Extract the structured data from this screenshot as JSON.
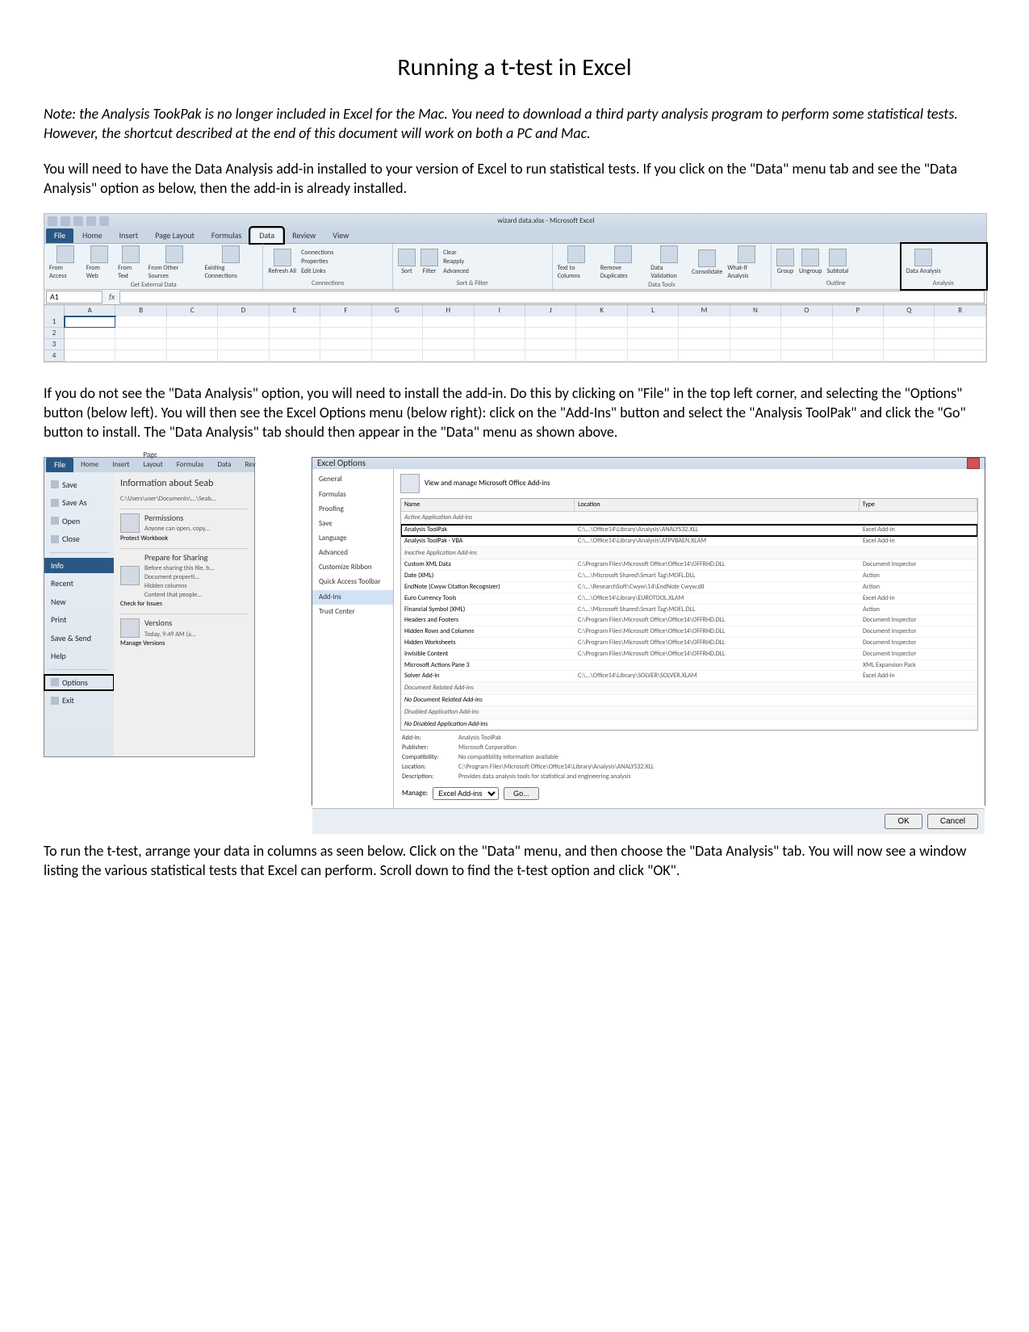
{
  "title": "Running a t-test in Excel",
  "note": "Note: the Analysis TookPak is no longer included in Excel for the Mac. You need to download a third party analysis program to perform some statistical tests. However, the shortcut described at the end of this document will work on both a PC and Mac.",
  "para1": "You will need to have the Data Analysis add-in installed to your version of Excel to run statistical tests. If you click on the \"Data\" menu tab and see the \"Data Analysis\" option as below, then the add-in is already installed.",
  "para2": "If you do not see the \"Data Analysis\" option, you will need to install the add-in. Do this by clicking on \"File\" in the top left corner, and selecting the \"Options\" button (below left). You will then see the Excel Options menu (below right): click on the \"Add-Ins\" button and select the \"Analysis ToolPak\" and click the \"Go\" button to install. The \"Data Analysis\" tab should then appear in the \"Data\" menu as shown above.",
  "para3": "To run the t-test, arrange your data in columns as seen below. Click on the \"Data\" menu, and then choose the \"Data Analysis\" tab. You will now see a window listing the various statistical tests that Excel can perform. Scroll down to find the t-test option and click \"OK\".",
  "ribbon": {
    "window_title": "wizard data.xlsx - Microsoft Excel",
    "tabs": [
      "Home",
      "Insert",
      "Page Layout",
      "Formulas",
      "Data",
      "Review",
      "View"
    ],
    "file": "File",
    "groups": {
      "ext": {
        "items": [
          "From Access",
          "From Web",
          "From Text",
          "From Other Sources",
          "Existing Connections"
        ],
        "name": "Get External Data"
      },
      "conn": {
        "items": [
          "Refresh All",
          "Connections",
          "Properties",
          "Edit Links"
        ],
        "name": "Connections"
      },
      "sort": {
        "items": [
          "Sort",
          "Filter",
          "Clear",
          "Reapply",
          "Advanced"
        ],
        "name": "Sort & Filter"
      },
      "tools": {
        "items": [
          "Text to Columns",
          "Remove Duplicates",
          "Data Validation",
          "Consolidate",
          "What-If Analysis"
        ],
        "name": "Data Tools"
      },
      "outline": {
        "items": [
          "Group",
          "Ungroup",
          "Subtotal"
        ],
        "name": "Outline"
      },
      "analysis": {
        "items": [
          "Data Analysis"
        ],
        "name": "Analysis"
      }
    },
    "namebox": "A1",
    "cols": [
      "A",
      "B",
      "C",
      "D",
      "E",
      "F",
      "G",
      "H",
      "I",
      "J",
      "K",
      "L",
      "M",
      "N",
      "O",
      "P",
      "Q",
      "R"
    ],
    "rows": [
      "1",
      "2",
      "3",
      "4"
    ]
  },
  "filemenu": {
    "tabs": [
      "Home",
      "Insert",
      "Page Layout",
      "Formulas",
      "Data",
      "Rev"
    ],
    "file": "File",
    "side": [
      "Save",
      "Save As",
      "Open",
      "Close",
      "Info",
      "Recent",
      "New",
      "Print",
      "Save & Send",
      "Help",
      "Options",
      "Exit"
    ],
    "selected": "Info",
    "info_title": "Information about Seab",
    "info_path": "C:\\Users\\user\\Documents\\...\\Seab...",
    "perm_head": "Permissions",
    "perm_sub": "Anyone can open, copy...",
    "perm_btn": "Protect Workbook",
    "prep_head": "Prepare for Sharing",
    "prep_sub": "Before sharing this file, b...",
    "prep_btn": "Check for Issues",
    "prep_bullets": [
      "Document properti...",
      "Hidden columns",
      "Content that people..."
    ],
    "ver_head": "Versions",
    "ver_sub": "Today, 9:49 AM (a...",
    "ver_btn": "Manage Versions"
  },
  "options": {
    "title": "Excel Options",
    "side": [
      "General",
      "Formulas",
      "Proofing",
      "Save",
      "Language",
      "Advanced",
      "Customize Ribbon",
      "Quick Access Toolbar",
      "Add-Ins",
      "Trust Center"
    ],
    "sel": "Add-Ins",
    "head": "View and manage Microsoft Office Add-ins",
    "cols": [
      "Name",
      "Location",
      "Type"
    ],
    "active_group": "Active Application Add-ins",
    "active": [
      {
        "n": "Analysis ToolPak",
        "l": "C:\\...\\Office14\\Library\\Analysis\\ANALYS32.XLL",
        "t": "Excel Add-in"
      },
      {
        "n": "Analysis ToolPak - VBA",
        "l": "C:\\...\\Office14\\Library\\Analysis\\ATPVBAEN.XLAM",
        "t": "Excel Add-in"
      }
    ],
    "inactive_group": "Inactive Application Add-ins",
    "inactive": [
      {
        "n": "Custom XML Data",
        "l": "C:\\Program Files\\Microsoft Office\\Office14\\OFFRHD.DLL",
        "t": "Document Inspector"
      },
      {
        "n": "Date (XML)",
        "l": "C:\\...\\Microsoft Shared\\Smart Tag\\MOFL.DLL",
        "t": "Action"
      },
      {
        "n": "EndNote (Cwyw Citation Recognizer)",
        "l": "C:\\...\\ResearchSoft\\Cwyw\\14\\EndNote Cwyw.dll",
        "t": "Action"
      },
      {
        "n": "Euro Currency Tools",
        "l": "C:\\...\\Office14\\Library\\EUROTOOL.XLAM",
        "t": "Excel Add-in"
      },
      {
        "n": "Financial Symbol (XML)",
        "l": "C:\\...\\Microsoft Shared\\Smart Tag\\MOFL.DLL",
        "t": "Action"
      },
      {
        "n": "Headers and Footers",
        "l": "C:\\Program Files\\Microsoft Office\\Office14\\OFFRHD.DLL",
        "t": "Document Inspector"
      },
      {
        "n": "Hidden Rows and Columns",
        "l": "C:\\Program Files\\Microsoft Office\\Office14\\OFFRHD.DLL",
        "t": "Document Inspector"
      },
      {
        "n": "Hidden Worksheets",
        "l": "C:\\Program Files\\Microsoft Office\\Office14\\OFFRHD.DLL",
        "t": "Document Inspector"
      },
      {
        "n": "Invisible Content",
        "l": "C:\\Program Files\\Microsoft Office\\Office14\\OFFRHD.DLL",
        "t": "Document Inspector"
      },
      {
        "n": "Microsoft Actions Pane 3",
        "l": "",
        "t": "XML Expansion Pack"
      },
      {
        "n": "Solver Add-in",
        "l": "C:\\...\\Office14\\Library\\SOLVER\\SOLVER.XLAM",
        "t": "Excel Add-in"
      }
    ],
    "docrel_group": "Document Related Add-ins",
    "docrel_none": "No Document Related Add-ins",
    "disabled_group": "Disabled Application Add-ins",
    "disabled_none": "No Disabled Application Add-ins",
    "detail": {
      "addin_k": "Add-in:",
      "addin_v": "Analysis ToolPak",
      "pub_k": "Publisher:",
      "pub_v": "Microsoft Corporation",
      "compat_k": "Compatibility:",
      "compat_v": "No compatibility information available",
      "loc_k": "Location:",
      "loc_v": "C:\\Program Files\\Microsoft Office\\Office14\\Library\\Analysis\\ANALYS32.XLL",
      "desc_k": "Description:",
      "desc_v": "Provides data analysis tools for statistical and engineering analysis"
    },
    "manage_label": "Manage:",
    "manage_value": "Excel Add-ins",
    "go": "Go...",
    "ok": "OK",
    "cancel": "Cancel"
  }
}
